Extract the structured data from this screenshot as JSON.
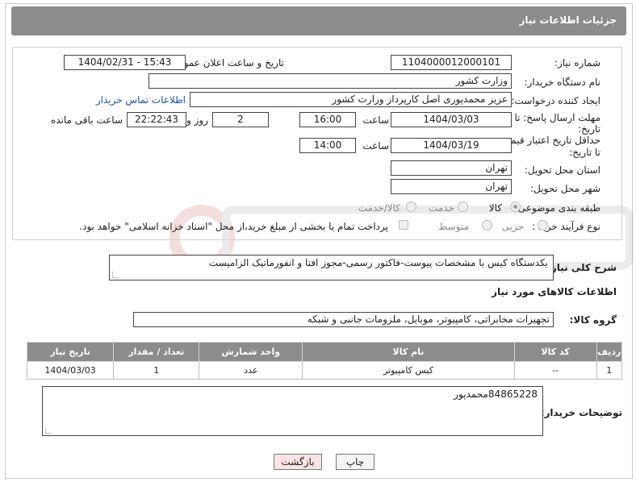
{
  "header": {
    "title": "جزئیات اطلاعات نیاز"
  },
  "fields": {
    "need_number_label": "شماره نیاز:",
    "need_number": "1104000012000101",
    "announce_label": "تاریخ و ساعت اعلان عمومی:",
    "announce_value": "1404/02/31 - 15:43",
    "buyer_org_label": "نام دستگاه خریدار:",
    "buyer_org": "وزارت کشور",
    "requester_label": "ایجاد کننده درخواست:",
    "requester": "عزیز محمدپوری اصل کارپرداز وزارت کشور",
    "contact_link": "اطلاعات تماس خریدار",
    "reply_deadline_label_1": "مهلت ارسال پاسخ: تا",
    "reply_deadline_label_2": "تاریخ:",
    "reply_date": "1404/03/03",
    "time_label": "ساعت",
    "reply_time": "16:00",
    "days_value": "2",
    "days_label": "روز و",
    "remaining_time": "22:22:43",
    "remaining_label": "ساعت باقی مانده",
    "price_validity_label_1": "حداقل تاریخ اعتبار قیمت:",
    "price_validity_label_2": "تا تاریخ:",
    "validity_date": "1404/03/19",
    "validity_time": "14:00",
    "province_label": "استان محل تحویل:",
    "province": "تهران",
    "city_label": "شهر محل تحویل:",
    "city": "تهران",
    "category_label": "طبقه بندی موضوعی:",
    "category_options": [
      "کالا",
      "خدمت",
      "کالا/خدمت"
    ],
    "process_label": "نوع فرآیند خرید :",
    "process_options": [
      "جزیی",
      "متوسط"
    ],
    "payment_note": "پرداخت تمام یا بخشی از مبلغ خرید،از محل \"اسناد خزانه اسلامی\" خواهد بود."
  },
  "description": {
    "label": "شرح کلی نیاز:",
    "value": "یکدستگاه کیس با مشخصات پیوست-فاکتور رسمی-مجوز افتا و انفورماتیک الزامیست"
  },
  "goods": {
    "section_title": "اطلاعات کالاهای مورد نیاز",
    "group_label": "گروه کالا:",
    "group_value": "تجهیزات مخابراتی، کامپیوتر، موبایل، ملزومات جانبی و شبکه",
    "columns": [
      "ردیف",
      "کد کالا",
      "نام کالا",
      "واحد شمارش",
      "تعداد / مقدار",
      "تاریخ نیاز"
    ],
    "rows": [
      [
        "1",
        "--",
        "کیس کامپیوتر",
        "عدد",
        "1",
        "1404/03/03"
      ]
    ]
  },
  "buyer_notes": {
    "label": "توضیحات خریدار:",
    "value": "84865228محمدپور"
  },
  "buttons": {
    "print": "چاپ",
    "back": "بازگشت"
  }
}
